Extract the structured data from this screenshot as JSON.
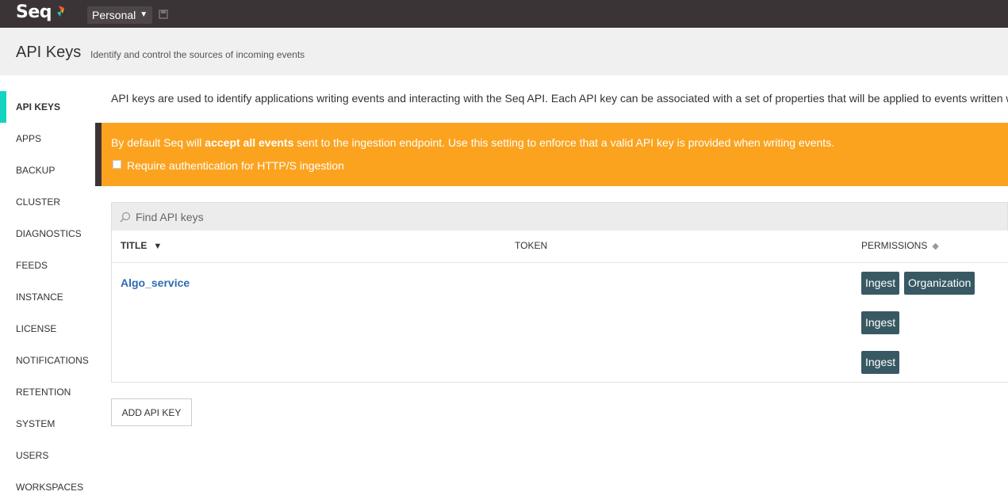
{
  "topbar": {
    "logo_text": "Seq",
    "workspace": "Personal"
  },
  "header": {
    "title": "API Keys",
    "subtitle": "Identify and control the sources of incoming events"
  },
  "sidebar": {
    "items": [
      {
        "label": "API KEYS",
        "active": true
      },
      {
        "label": "APPS"
      },
      {
        "label": "BACKUP"
      },
      {
        "label": "CLUSTER"
      },
      {
        "label": "DIAGNOSTICS"
      },
      {
        "label": "FEEDS"
      },
      {
        "label": "INSTANCE"
      },
      {
        "label": "LICENSE"
      },
      {
        "label": "NOTIFICATIONS"
      },
      {
        "label": "RETENTION"
      },
      {
        "label": "SYSTEM"
      },
      {
        "label": "USERS"
      },
      {
        "label": "WORKSPACES"
      }
    ]
  },
  "main": {
    "intro": "API keys are used to identify applications writing events and interacting with the Seq API. Each API key can be associated with a set of properties that will be applied to events written w",
    "alert": {
      "text_before": "By default Seq will ",
      "text_bold": "accept all events",
      "text_after": " sent to the ingestion endpoint. Use this setting to enforce that a valid API key is provided when writing events.",
      "checkbox_label": "Require authentication for HTTP/S ingestion"
    },
    "search": {
      "placeholder": "Find API keys"
    },
    "table": {
      "columns": {
        "title": "TITLE",
        "token": "TOKEN",
        "permissions": "PERMISSIONS"
      },
      "sort_indicator": "▼",
      "rows": [
        {
          "title": "Algo_service",
          "permissions": [
            "Ingest",
            "Organization"
          ]
        },
        {
          "title": "",
          "permissions": [
            "Ingest"
          ]
        },
        {
          "title": "",
          "permissions": [
            "Ingest"
          ]
        }
      ]
    },
    "add_button": "ADD API KEY"
  },
  "colors": {
    "topbar": "#3a3437",
    "accent": "#14d4c1",
    "alert": "#fba31f",
    "badge": "#385964",
    "link": "#2e6bb3"
  }
}
